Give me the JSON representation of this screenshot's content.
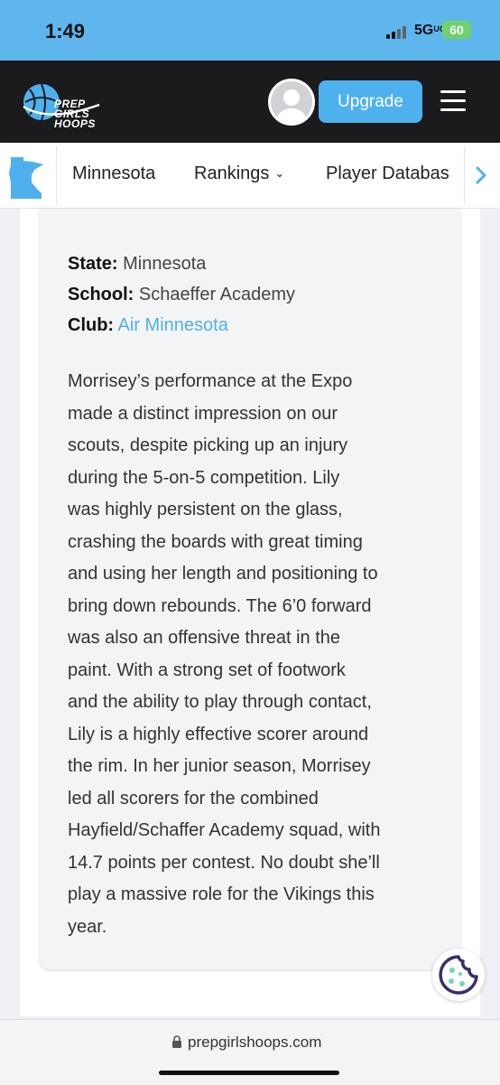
{
  "status_bar": {
    "time": "1:49",
    "network": "5G",
    "network_suffix": "UC",
    "battery": "60"
  },
  "header": {
    "logo_lines": [
      "PREP",
      "GIRLS",
      "HOOPS"
    ],
    "upgrade_label": "Upgrade",
    "icons": [
      "logo-icon",
      "avatar-icon",
      "hamburger-menu-icon"
    ]
  },
  "nav": {
    "items": [
      {
        "label": "Minnesota"
      },
      {
        "label": "Rankings"
      },
      {
        "label": "Player Databas"
      }
    ],
    "icons": [
      "minnesota-state-icon",
      "chevron-down-icon",
      "chevron-right-icon"
    ]
  },
  "profile": {
    "state_label": "State:",
    "state_value": "Minnesota",
    "school_label": "School:",
    "school_value": "Schaeffer Academy",
    "club_label": "Club:",
    "club_value": "Air Minnesota",
    "bio_lines": [
      "Morrisey’s performance at the Expo",
      "made a distinct impression on our",
      "scouts, despite picking up an injury",
      "during the 5-on-5 competition. Lily",
      "was highly persistent on the glass,",
      "crashing the boards with great timing",
      "and using her length and positioning to",
      "bring down rebounds. The 6’0 forward",
      "was also an offensive threat in the",
      "paint. With a strong set of footwork",
      "and the ability to play through contact,",
      "Lily is a highly effective scorer around",
      "the rim. In her junior season, Morrisey",
      "led all scorers for the combined",
      "Hayfield/Schaffer Academy squad, with",
      "14.7 points per contest. No doubt she’ll",
      "play a massive role for the Vikings this",
      "year."
    ]
  },
  "browser": {
    "url": "prepgirlshoops.com"
  },
  "colors": {
    "accent": "#4fb0ee",
    "header_bg": "#1b1b1d",
    "status_bg": "#5eb6ec",
    "cookie_icon": "#3d2d6e",
    "cookie_dots": "#6fd6c0"
  }
}
